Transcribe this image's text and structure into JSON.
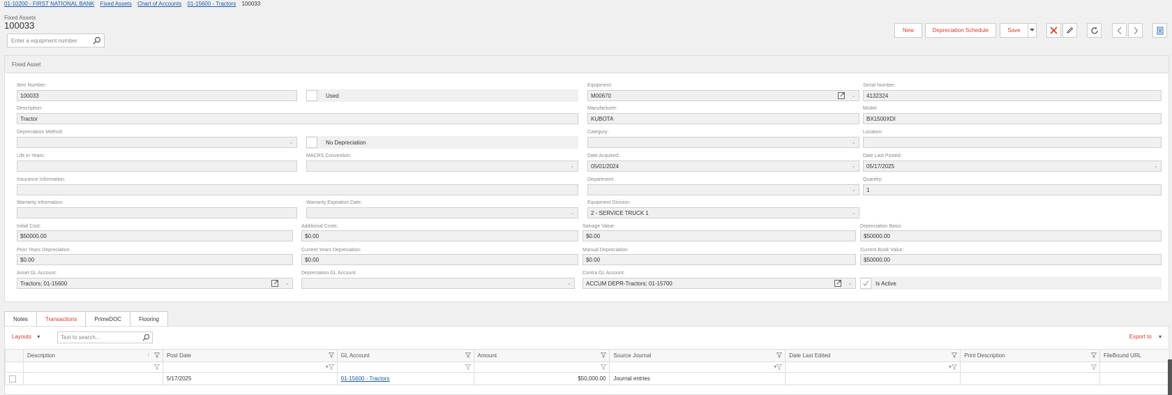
{
  "breadcrumb": {
    "links": [
      "01-10200 - FIRST NATIONAL BANK",
      "Fixed Assets",
      "Chart of Accounts",
      "01-15600 - Tractors"
    ],
    "current": "100033"
  },
  "header": {
    "module": "Fixed Assets",
    "record": "100033",
    "search_placeholder": "Enter a equipment number"
  },
  "toolbar": {
    "new_label": "New",
    "depreciation_schedule_label": "Depreciation Schedule",
    "save_label": "Save"
  },
  "panel": {
    "title": "Fixed Asset",
    "fields": {
      "item_number": {
        "label": "Item Number:",
        "value": "100033"
      },
      "used": {
        "label": "Used"
      },
      "equipment": {
        "label": "Equipment:",
        "value": "M00670"
      },
      "serial_number": {
        "label": "Serial Number:",
        "value": "4132324"
      },
      "description": {
        "label": "Description:",
        "value": "Tractor"
      },
      "manufacturer": {
        "label": "Manufacturer:",
        "value": "KUBOTA"
      },
      "model": {
        "label": "Model:",
        "value": "BX1500XDI"
      },
      "depreciation_method": {
        "label": "Depreciation Method:",
        "value": ""
      },
      "no_depreciation": {
        "label": "No Depreciation"
      },
      "category": {
        "label": "Category:",
        "value": ""
      },
      "location": {
        "label": "Location:",
        "value": ""
      },
      "life_in_years": {
        "label": "Life In Years:",
        "value": ""
      },
      "macrs_convention": {
        "label": "MACRS Convention:",
        "value": ""
      },
      "date_acquired": {
        "label": "Date Acquired:",
        "value": "05/01/2024"
      },
      "date_last_posted": {
        "label": "Date Last Posted:",
        "value": "05/17/2025"
      },
      "insurance_information": {
        "label": "Insurance Information:",
        "value": ""
      },
      "department": {
        "label": "Department:",
        "value": ""
      },
      "quantity": {
        "label": "Quantity:",
        "value": "1"
      },
      "warranty_information": {
        "label": "Warranty Information:",
        "value": ""
      },
      "warranty_expiration_date": {
        "label": "Warranty Expiration Date:",
        "value": ""
      },
      "equipment_division": {
        "label": "Equipment Division:",
        "value": "2 - SERVICE TRUCK 1"
      },
      "initial_cost": {
        "label": "Initial Cost:",
        "value": "$50000.00"
      },
      "additional_costs": {
        "label": "Additional Costs:",
        "value": "$0.00"
      },
      "salvage_value": {
        "label": "Salvage Value:",
        "value": "$0.00"
      },
      "depreciation_basis": {
        "label": "Depreciation Basis:",
        "value": "$50000.00"
      },
      "prior_years_depreciation": {
        "label": "Prior Years Depreciation:",
        "value": "$0.00"
      },
      "current_years_depreciation": {
        "label": "Current Years Depreciation:",
        "value": "$0.00"
      },
      "manual_depreciation": {
        "label": "Manual Depreciation:",
        "value": "$0.00"
      },
      "current_book_value": {
        "label": "Current Book Value:",
        "value": "$50000.00"
      },
      "asset_gl_account": {
        "label": "Asset GL Account:",
        "value": "Tractors; 01-15600"
      },
      "depreciation_gl_account": {
        "label": "Depreciation GL Account:",
        "value": ""
      },
      "contra_gl_account": {
        "label": "Contra GL Account:",
        "value": "ACCUM DEPR-Tractors; 01-15700"
      },
      "is_active": {
        "label": "Is Active",
        "checked": true
      }
    }
  },
  "tabs": [
    {
      "label": "Notes",
      "active": false
    },
    {
      "label": "Transactions",
      "active": true
    },
    {
      "label": "PrimeDOC",
      "active": false
    },
    {
      "label": "Flooring",
      "active": false
    }
  ],
  "grid": {
    "layouts_label": "Layouts",
    "search_placeholder": "Text to search...",
    "export_label": "Export to",
    "columns": [
      "Description",
      "Post Date",
      "GL Account",
      "Amount",
      "Source Journal",
      "Date Last Edited",
      "Print Description",
      "FileBound URL"
    ],
    "rows": [
      {
        "description": "",
        "post_date": "5/17/2025",
        "gl_account": "01-15600 - Tractors",
        "amount": "$50,000.00",
        "source_journal": "Journal entries",
        "date_last_edited": "",
        "print_description": "",
        "filebound_url": ""
      }
    ]
  }
}
